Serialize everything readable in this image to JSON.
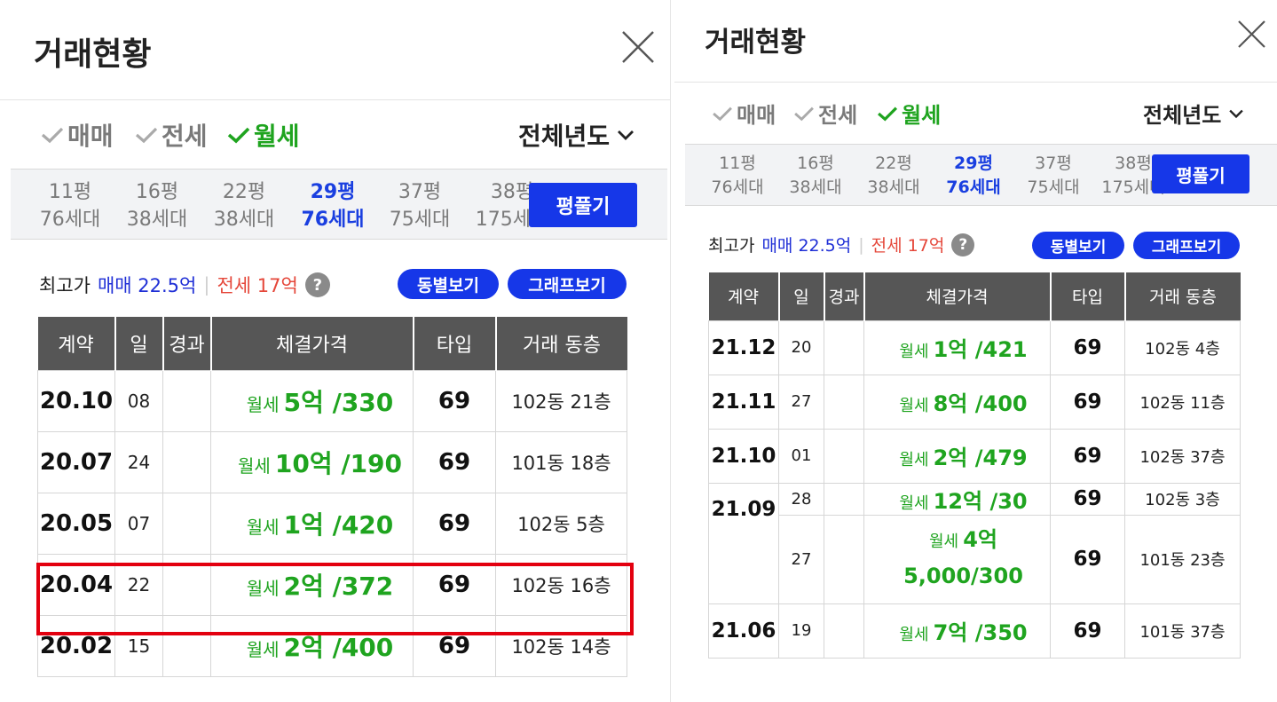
{
  "colors": {
    "accent_blue": "#1637e8",
    "rent_green": "#1fa41f",
    "sale_blue": "#1f2fd6",
    "jeonse_red": "#e5473a",
    "header_gray": "#565656",
    "highlight_red": "#e3000f"
  },
  "icons": {
    "close": "close-icon",
    "check": "check-icon",
    "chevron": "chevron-down-icon",
    "help": "help-icon"
  },
  "left": {
    "title": "거래현황",
    "filters": [
      {
        "label": "매매",
        "checked": false
      },
      {
        "label": "전세",
        "checked": false
      },
      {
        "label": "월세",
        "checked": true
      }
    ],
    "year_select": "전체년도",
    "sizes": [
      {
        "pyeong": "11평",
        "households": "76세대",
        "active": false
      },
      {
        "pyeong": "16평",
        "households": "38세대",
        "active": false
      },
      {
        "pyeong": "22평",
        "households": "38세대",
        "active": false
      },
      {
        "pyeong": "29평",
        "households": "76세대",
        "active": true
      },
      {
        "pyeong": "37평",
        "households": "75세대",
        "active": false
      },
      {
        "pyeong": "38평",
        "households": "175세대",
        "active": false
      }
    ],
    "pyeong_button": "평풀기",
    "max_price": {
      "label": "최고가",
      "sale": "매매 22.5억",
      "separator": "|",
      "jeonse": "전세 17억",
      "help": "?"
    },
    "pills": {
      "dong_view": "동별보기",
      "graph_view": "그래프보기"
    },
    "columns": [
      "계약",
      "일",
      "경과",
      "체결가격",
      "타입",
      "거래 동층"
    ],
    "rows": [
      {
        "ym": "20.10",
        "day": "08",
        "elapsed": "",
        "kind": "월세",
        "price": "5억 /330",
        "type": "69",
        "location": "102동 21층"
      },
      {
        "ym": "20.07",
        "day": "24",
        "elapsed": "",
        "kind": "월세",
        "price": "10억 /190",
        "type": "69",
        "location": "101동 18층"
      },
      {
        "ym": "20.05",
        "day": "07",
        "elapsed": "",
        "kind": "월세",
        "price": "1억 /420",
        "type": "69",
        "location": "102동   5층"
      },
      {
        "ym": "20.04",
        "day": "22",
        "elapsed": "",
        "kind": "월세",
        "price": "2억 /372",
        "type": "69",
        "location": "102동 16층"
      },
      {
        "ym": "20.02",
        "day": "15",
        "elapsed": "",
        "kind": "월세",
        "price": "2억 /400",
        "type": "69",
        "location": "102동 14층"
      }
    ]
  },
  "right": {
    "title": "거래현황",
    "filters": [
      {
        "label": "매매",
        "checked": false
      },
      {
        "label": "전세",
        "checked": false
      },
      {
        "label": "월세",
        "checked": true
      }
    ],
    "year_select": "전체년도",
    "sizes": [
      {
        "pyeong": "11평",
        "households": "76세대",
        "active": false
      },
      {
        "pyeong": "16평",
        "households": "38세대",
        "active": false
      },
      {
        "pyeong": "22평",
        "households": "38세대",
        "active": false
      },
      {
        "pyeong": "29평",
        "households": "76세대",
        "active": true
      },
      {
        "pyeong": "37평",
        "households": "75세대",
        "active": false
      },
      {
        "pyeong": "38평",
        "households": "175세대",
        "active": false
      }
    ],
    "pyeong_button": "평풀기",
    "max_price": {
      "label": "최고가",
      "sale": "매매 22.5억",
      "separator": "|",
      "jeonse": "전세 17억",
      "help": "?"
    },
    "pills": {
      "dong_view": "동별보기",
      "graph_view": "그래프보기"
    },
    "columns": [
      "계약",
      "일",
      "경과",
      "체결가격",
      "타입",
      "거래 동층"
    ],
    "rows": [
      {
        "ym": "21.12",
        "day": "20",
        "elapsed": "",
        "kind": "월세",
        "price": "1억 /421",
        "type": "69",
        "location": "102동   4층"
      },
      {
        "ym": "21.11",
        "day": "27",
        "elapsed": "",
        "kind": "월세",
        "price": "8억 /400",
        "type": "69",
        "location": "102동 11층"
      },
      {
        "ym": "21.10",
        "day": "01",
        "elapsed": "",
        "kind": "월세",
        "price": "2억 /479",
        "type": "69",
        "location": "102동 37층"
      },
      {
        "ym": "21.09",
        "day": "28",
        "elapsed": "",
        "kind": "월세",
        "price": "12억 /30",
        "type": "69",
        "location": "102동   3층"
      },
      {
        "ym": "",
        "day": "27",
        "elapsed": "",
        "kind": "월세",
        "price": "4억",
        "price2": "5,000/300",
        "type": "69",
        "location": "101동 23층"
      },
      {
        "ym": "21.06",
        "day": "19",
        "elapsed": "",
        "kind": "월세",
        "price": "7억 /350",
        "type": "69",
        "location": "101동 37층"
      }
    ]
  }
}
